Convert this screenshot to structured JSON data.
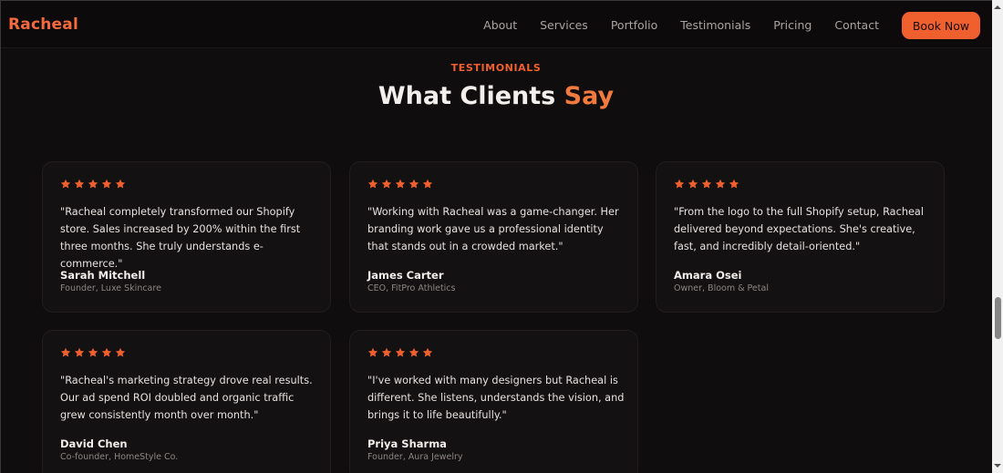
{
  "brand": {
    "name": "Racheal",
    "accent_color": "#f0602f"
  },
  "nav": {
    "links": [
      "About",
      "Services",
      "Portfolio",
      "Testimonials",
      "Pricing",
      "Contact"
    ],
    "cta_label": "Book Now"
  },
  "section": {
    "eyebrow": "TESTIMONIALS",
    "title_main": "What Clients",
    "title_accent": "Say"
  },
  "testimonials": [
    {
      "rating": 5,
      "quote": "\"Racheal completely transformed our Shopify store. Sales increased by 200% within the first three months. She truly understands e-commerce.\"",
      "name": "Sarah Mitchell",
      "role": "Founder, Luxe Skincare"
    },
    {
      "rating": 5,
      "quote": "\"Working with Racheal was a game-changer. Her branding work gave us a professional identity that stands out in a crowded market.\"",
      "name": "James Carter",
      "role": "CEO, FitPro Athletics"
    },
    {
      "rating": 5,
      "quote": "\"From the logo to the full Shopify setup, Racheal delivered beyond expectations. She's creative, fast, and incredibly detail-oriented.\"",
      "name": "Amara Osei",
      "role": "Owner, Bloom & Petal"
    },
    {
      "rating": 5,
      "quote": "\"Racheal's marketing strategy drove real results. Our ad spend ROI doubled and organic traffic grew consistently month over month.\"",
      "name": "David Chen",
      "role": "Co-founder, HomeStyle Co."
    },
    {
      "rating": 5,
      "quote": "\"I've worked with many designers but Racheal is different. She listens, understands the vision, and brings it to life beautifully.\"",
      "name": "Priya Sharma",
      "role": "Founder, Aura Jewelry"
    }
  ],
  "icons": {
    "star": "star-icon",
    "scroll_up": "chevron-up-icon",
    "scroll_down": "chevron-down-icon"
  }
}
